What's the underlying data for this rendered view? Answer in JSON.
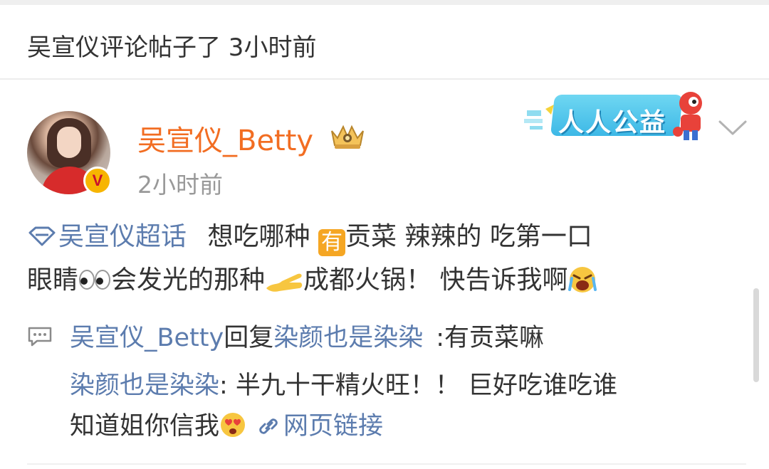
{
  "header": {
    "title": "吴宣仪评论帖子了 3小时前"
  },
  "post": {
    "username": "吴宣仪_Betty",
    "timestamp": "2小时前",
    "verified_badge": "V",
    "promo_banner": "人人公益",
    "body": {
      "topic": "吴宣仪超话",
      "line1_a": "想吃哪种",
      "emoji_you": "有",
      "line1_b": "贡菜 辣辣的 吃第一口",
      "line2_a": "眼睛",
      "line2_b": "会发光的那种",
      "line2_c": "成都火锅！ 快告诉我啊"
    }
  },
  "comments": {
    "reply_author": "吴宣仪_Betty",
    "reply_word": "回复",
    "reply_target": "染颜也是染染",
    "reply_text": ":有贡菜嘛",
    "quote_author": "染颜也是染染",
    "quote_text_1": ": 半九十干精火旺！！ 巨好吃谁吃谁",
    "quote_text_2": "知道姐你信我",
    "web_link": "网页链接"
  },
  "icons": {
    "topic": "diamond-topic-icon",
    "crown": "crown-member-icon",
    "comment": "comment-bubble-icon",
    "link": "link-icon",
    "chevron": "chevron-down-icon"
  },
  "colors": {
    "username": "#f26d22",
    "link": "#5c7cae",
    "muted": "#999999",
    "text": "#333333"
  }
}
